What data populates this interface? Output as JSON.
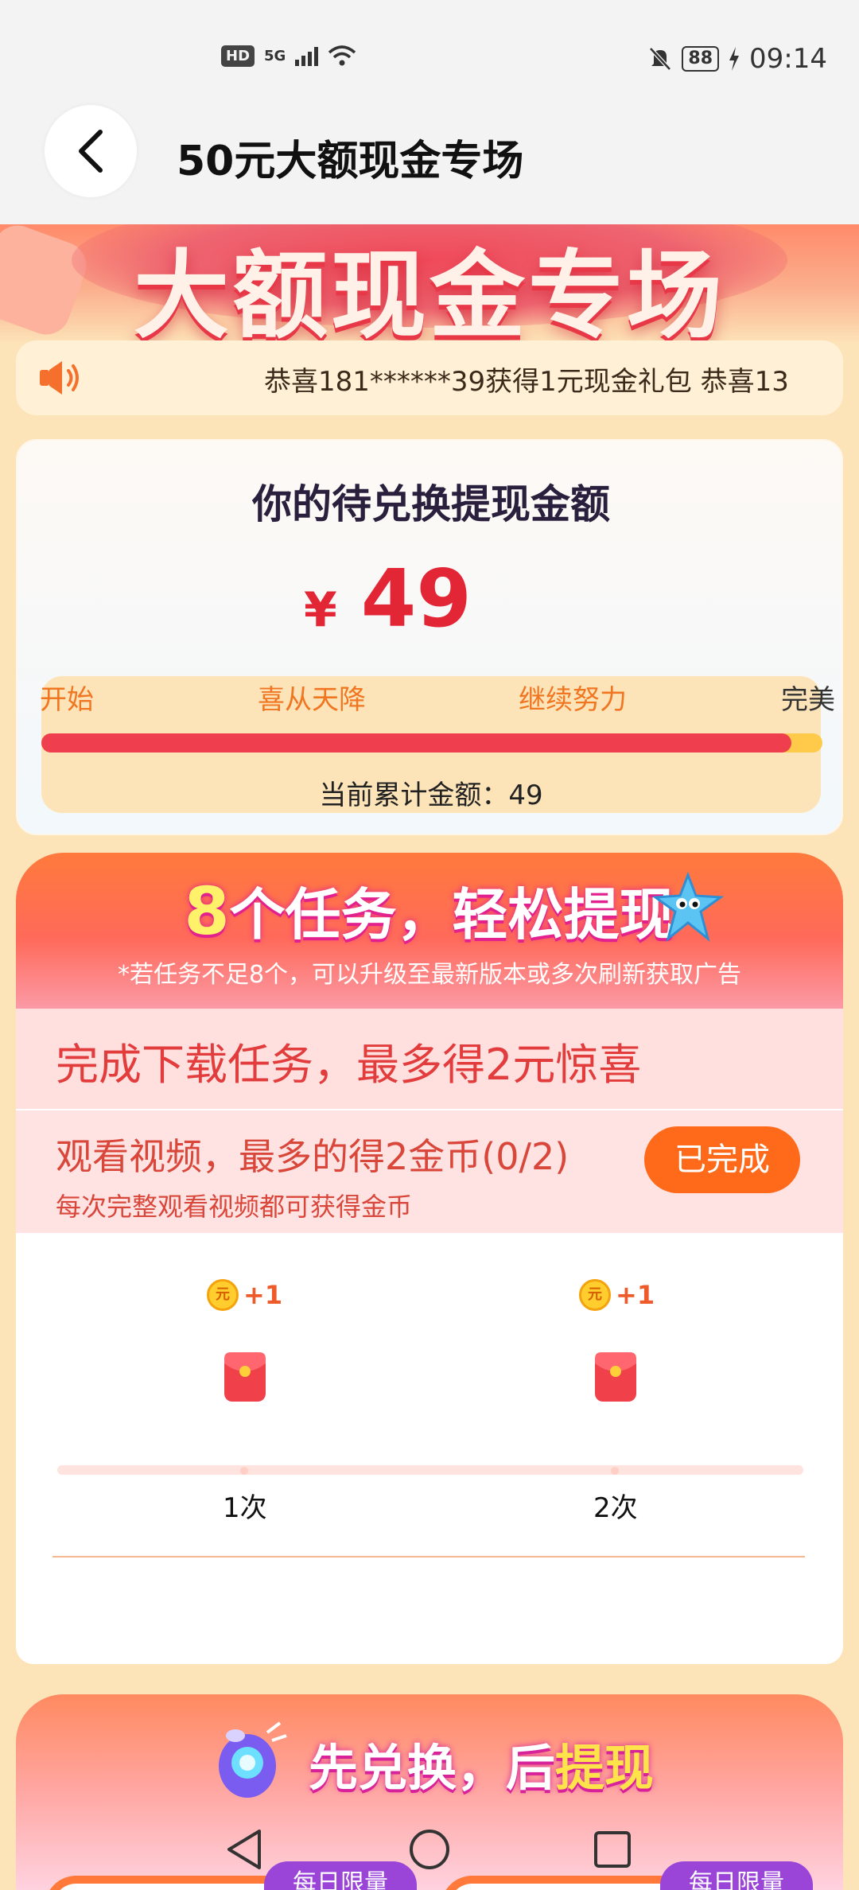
{
  "status_bar": {
    "hd": "HD",
    "network": "5G",
    "battery": "88",
    "time": "09:14"
  },
  "header": {
    "title": "50元大额现金专场"
  },
  "hero": {
    "title": "大额现金专场"
  },
  "notice": {
    "text": "恭喜181******39获得1元现金礼包   恭喜13"
  },
  "balance": {
    "title": "你的待兑换提现金额",
    "currency": "¥",
    "amount": "49",
    "milestones": [
      "开始",
      "喜从天降",
      "继续努力",
      "完美"
    ],
    "progress": 0.96,
    "accumulated_label": "当前累计金额：49"
  },
  "tasks": {
    "count": "8",
    "headline_rest": "个任务，轻松提现",
    "subtitle": "*若任务不足8个，可以升级至最新版本或多次刷新获取广告",
    "download_title": "完成下载任务，最多得2元惊喜",
    "video": {
      "title": "观看视频，最多的得2金币(0/2)",
      "desc": "每次完整观看视频都可获得金币",
      "button": "已完成"
    },
    "steps": [
      {
        "reward": "+1",
        "coin": "元",
        "label": "1次"
      },
      {
        "reward": "+1",
        "coin": "元",
        "label": "2次"
      }
    ]
  },
  "exchange": {
    "title_part1": "先兑换，后",
    "title_part2": "提现",
    "tags": [
      "每日限量",
      "每日限量"
    ]
  },
  "colors": {
    "accent": "#ff6a1a",
    "red": "#e32636",
    "bg": "#fde3b8"
  },
  "icons": [
    "back-icon",
    "speaker-icon",
    "coin-icon",
    "red-packet-icon",
    "mascot-icon",
    "rocket-icon",
    "nav-back-icon",
    "nav-home-icon",
    "nav-recent-icon"
  ]
}
